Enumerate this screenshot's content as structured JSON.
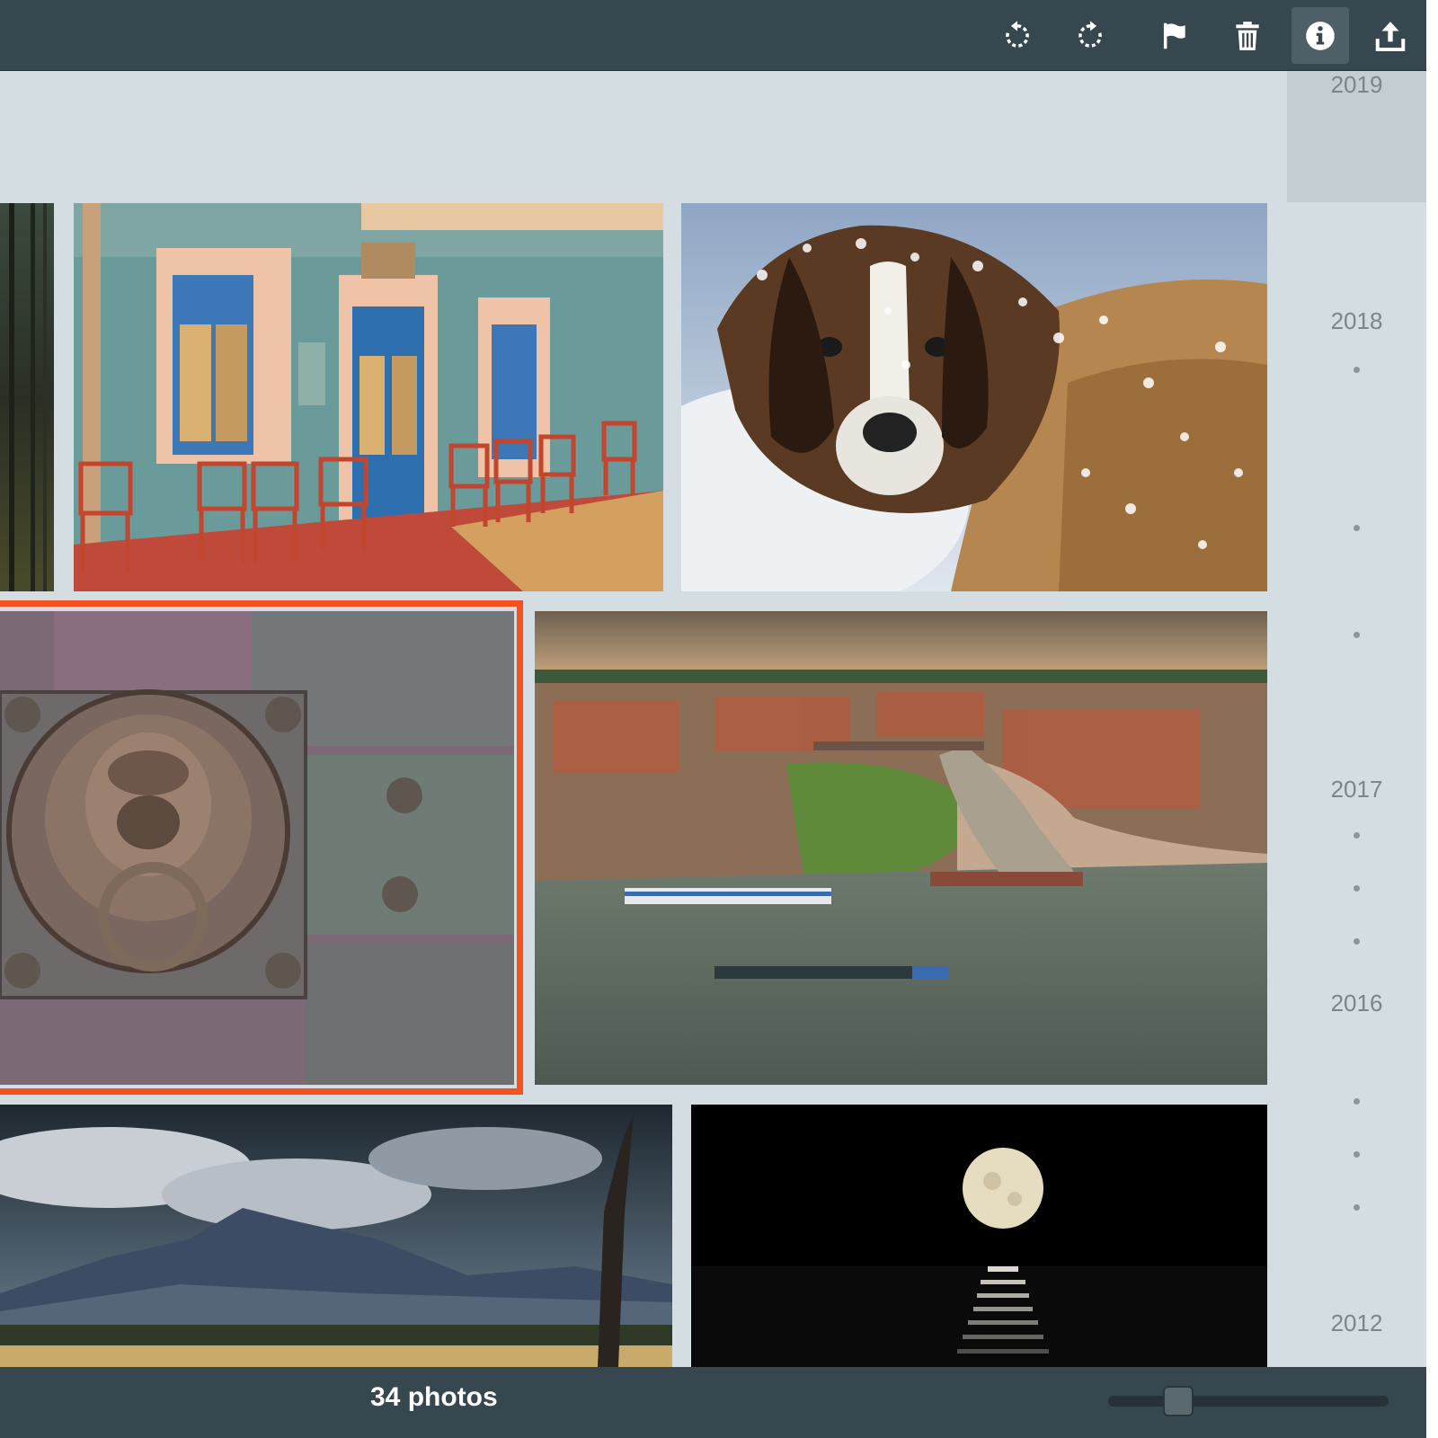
{
  "toolbar": {
    "buttons": [
      {
        "icon": "rotate-left-icon",
        "active": false
      },
      {
        "icon": "rotate-right-icon",
        "active": false
      },
      {
        "icon": "flag-icon",
        "active": false
      },
      {
        "icon": "trash-icon",
        "active": false
      },
      {
        "icon": "info-icon",
        "active": true
      },
      {
        "icon": "share-icon",
        "active": false
      }
    ]
  },
  "timeline": {
    "years": [
      "2019",
      "2018",
      "2017",
      "2016",
      "2012"
    ]
  },
  "photos": [
    {
      "subject": "forest"
    },
    {
      "subject": "cafe-storefront"
    },
    {
      "subject": "saint-bernard-dog-in-snow"
    },
    {
      "subject": "lion-door-knocker",
      "selected": true
    },
    {
      "subject": "river-city-aerial"
    },
    {
      "subject": "mountain-clouds"
    },
    {
      "subject": "moon-over-sea"
    }
  ],
  "status": {
    "photo_count": "34 photos",
    "zoom_level": 0.25
  },
  "colors": {
    "toolbar": "#37474f",
    "background": "#d4dde2",
    "selection": "#f4511e"
  }
}
